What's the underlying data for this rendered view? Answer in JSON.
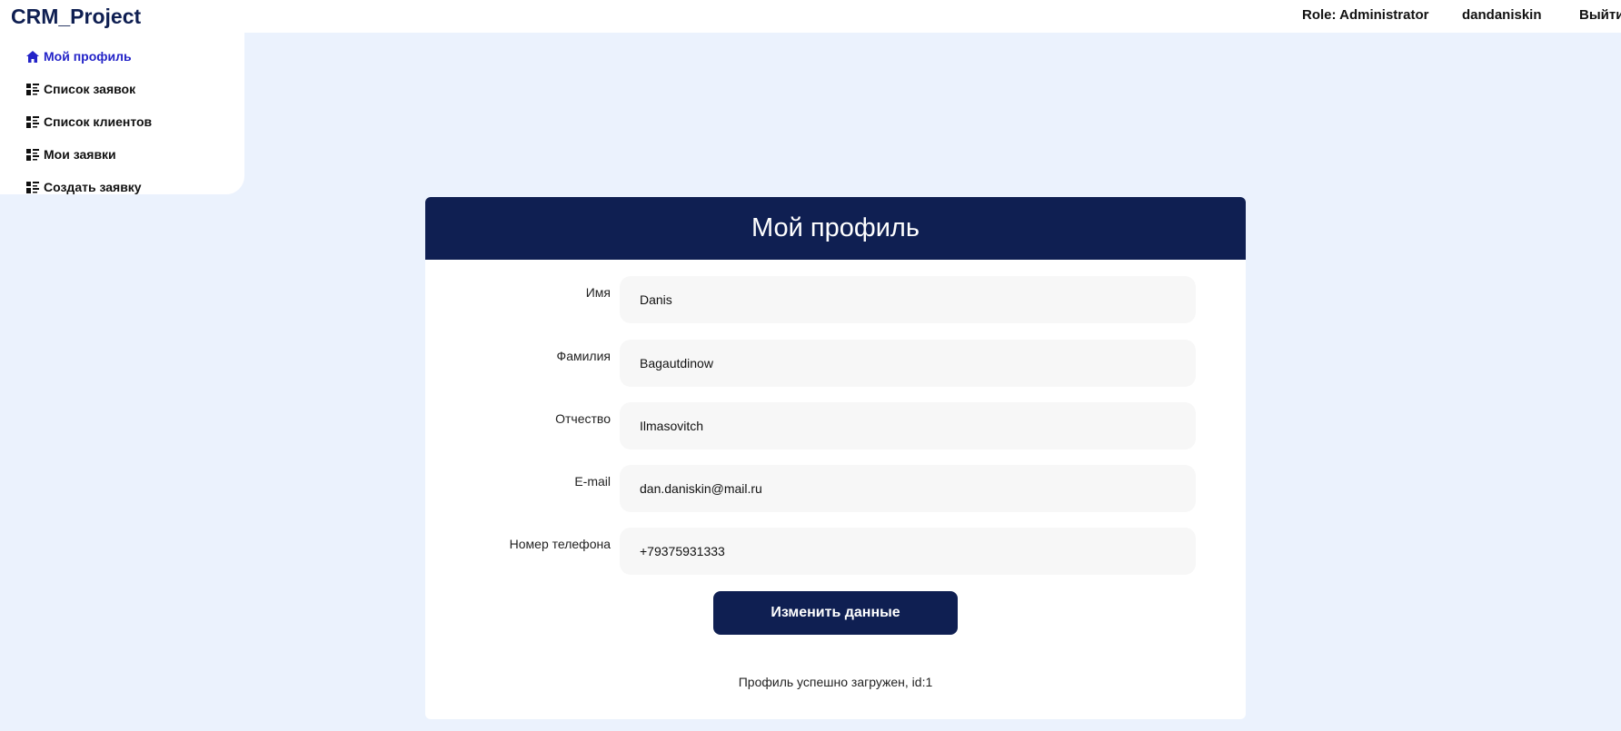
{
  "header": {
    "brand": "CRM_Project",
    "role": "Role: Administrator",
    "username": "dandaniskin",
    "logout": "Выйти"
  },
  "sidebar": {
    "items": [
      {
        "label": "Мой профиль",
        "icon": "home-icon",
        "active": true
      },
      {
        "label": "Список заявок",
        "icon": "list-icon"
      },
      {
        "label": "Список клиентов",
        "icon": "list-icon"
      },
      {
        "label": "Мои заявки",
        "icon": "list-icon"
      },
      {
        "label": "Создать заявку",
        "icon": "list-icon"
      }
    ]
  },
  "profile": {
    "title": "Мой профиль",
    "fields": [
      {
        "label": "Имя",
        "value": "Danis"
      },
      {
        "label": "Фамилия",
        "value": "Bagautdinow"
      },
      {
        "label": "Отчество",
        "value": "Ilmasovitch"
      },
      {
        "label": "E-mail",
        "value": "dan.daniskin@mail.ru"
      },
      {
        "label": "Номер телефона",
        "value": "+79375931333"
      }
    ],
    "submit_label": "Изменить данные",
    "status": "Профиль успешно загружен, id:1"
  },
  "colors": {
    "primary": "#0f1f52",
    "active_link": "#2323c8",
    "background": "#ebf2fd",
    "field_bg": "#f7f7f7"
  }
}
